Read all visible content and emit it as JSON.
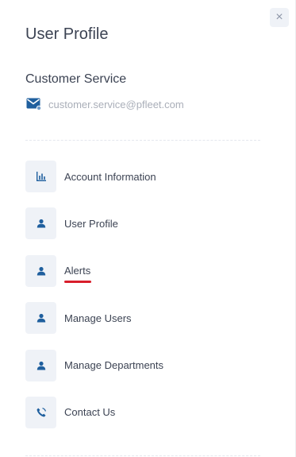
{
  "panel": {
    "title": "User Profile",
    "close_symbol": "×"
  },
  "account": {
    "name": "Customer Service",
    "email": "customer.service@pfleet.com",
    "email_icon": "mail-icon"
  },
  "menu": {
    "items": [
      {
        "label": "Account Information",
        "icon": "bar-chart-icon",
        "active": false
      },
      {
        "label": "User Profile",
        "icon": "user-icon",
        "active": false
      },
      {
        "label": "Alerts",
        "icon": "user-icon",
        "active": true
      },
      {
        "label": "Manage Users",
        "icon": "user-icon",
        "active": false
      },
      {
        "label": "Manage Departments",
        "icon": "user-icon",
        "active": false
      },
      {
        "label": "Contact Us",
        "icon": "phone-icon",
        "active": false
      }
    ]
  },
  "colors": {
    "accent": "#1f5f9e",
    "active_underline": "#d81e2b",
    "icon_tile": "#eff2f7",
    "text": "#3c4353",
    "muted": "#a9aeb8"
  }
}
